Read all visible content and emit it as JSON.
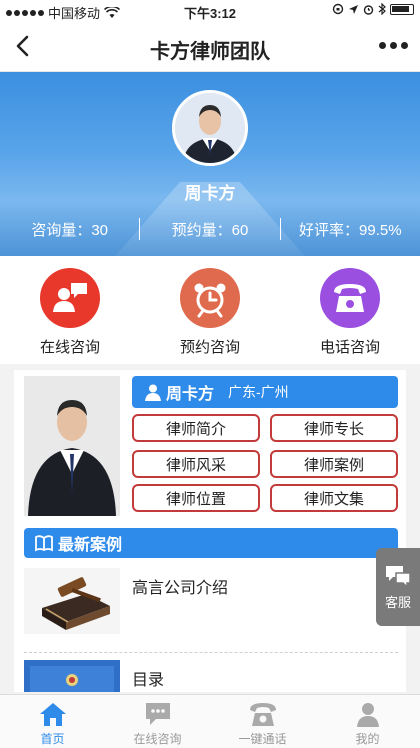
{
  "status_bar": {
    "carrier": "中国移动",
    "time": "下午3:12"
  },
  "nav": {
    "title": "卡方律师团队"
  },
  "hero": {
    "name": "周卡方",
    "stats": [
      {
        "label": "咨询量",
        "value": "30",
        "text": "咨询量：30"
      },
      {
        "label": "预约量",
        "value": "60",
        "text": "预约量：60"
      },
      {
        "label": "好评率",
        "value": "99.5%",
        "text": "好评率：99.5%"
      }
    ]
  },
  "services": [
    {
      "label": "在线咨询",
      "color": "#e8382c",
      "icon": "chat-icon"
    },
    {
      "label": "预约咨询",
      "color": "#e06a4e",
      "icon": "alarm-clock-icon"
    },
    {
      "label": "电话咨询",
      "color": "#9b4fe0",
      "icon": "phone-icon"
    }
  ],
  "profile": {
    "name": "周卡方",
    "location": "广东-广州",
    "buttons": [
      "律师简介",
      "律师专长",
      "律师风采",
      "律师案例",
      "律师位置",
      "律师文集"
    ]
  },
  "latest_cases": {
    "title": "最新案例",
    "items": [
      {
        "title": "高言公司介绍"
      },
      {
        "title": "目录"
      }
    ]
  },
  "float_service": {
    "label": "客服"
  },
  "tabs": [
    {
      "label": "首页",
      "active": true
    },
    {
      "label": "在线咨询",
      "active": false
    },
    {
      "label": "一键通话",
      "active": false
    },
    {
      "label": "我的",
      "active": false
    }
  ],
  "colors": {
    "accent": "#2f8bea",
    "button_border": "#c23a3a"
  }
}
